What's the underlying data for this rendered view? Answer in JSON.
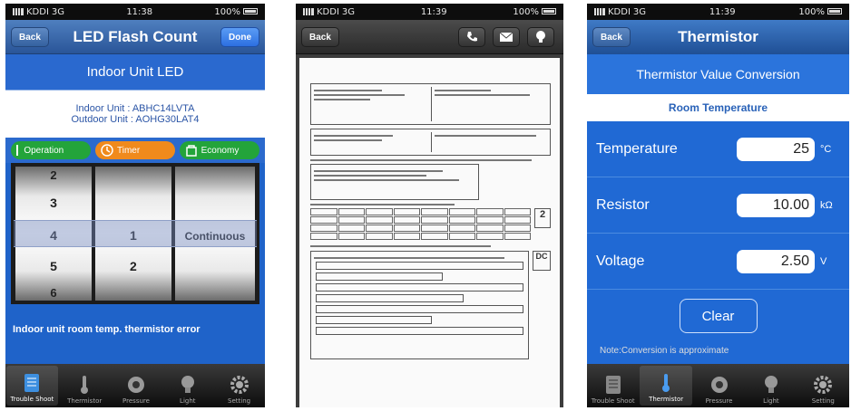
{
  "screens": [
    {
      "status": {
        "carrier": "KDDI",
        "network": "3G",
        "time": "11:38",
        "battery": "100%"
      },
      "nav": {
        "title": "LED Flash Count",
        "back_label": "Back",
        "done_label": "Done"
      },
      "section_title": "Indoor Unit LED",
      "indoor_unit": "Indoor Unit : ABHC14LVTA",
      "outdoor_unit": "Outdoor Unit : AOHG30LAT4",
      "modes": {
        "operation": "Operation",
        "timer": "Timer",
        "economy": "Economy"
      },
      "picker": {
        "col1": [
          "2",
          "3",
          "4",
          "5",
          "6"
        ],
        "col2": [
          "1",
          "2"
        ],
        "col3": [
          "Continuous"
        ]
      },
      "message": "Indoor unit room temp. thermistor error",
      "tabs": [
        "Trouble Shoot",
        "Thermistor",
        "Pressure",
        "Light",
        "Setting"
      ]
    },
    {
      "status": {
        "carrier": "KDDI",
        "network": "3G",
        "time": "11:39",
        "battery": "100%"
      },
      "nav": {
        "back_label": "Back"
      },
      "doc_badge_1": "2",
      "doc_badge_2": "DC"
    },
    {
      "status": {
        "carrier": "KDDI",
        "network": "3G",
        "time": "11:39",
        "battery": "100%"
      },
      "nav": {
        "title": "Thermistor",
        "back_label": "Back"
      },
      "header": "Thermistor Value Conversion",
      "subheader": "Room Temperature",
      "rows": [
        {
          "label": "Temperature",
          "value": "25",
          "unit": "°C"
        },
        {
          "label": "Resistor",
          "value": "10.00",
          "unit": "kΩ"
        },
        {
          "label": "Voltage",
          "value": "2.50",
          "unit": "V"
        }
      ],
      "clear_label": "Clear",
      "note": "Note:Conversion is approximate",
      "tabs": [
        "Trouble Shoot",
        "Thermistor",
        "Pressure",
        "Light",
        "Setting"
      ]
    }
  ]
}
